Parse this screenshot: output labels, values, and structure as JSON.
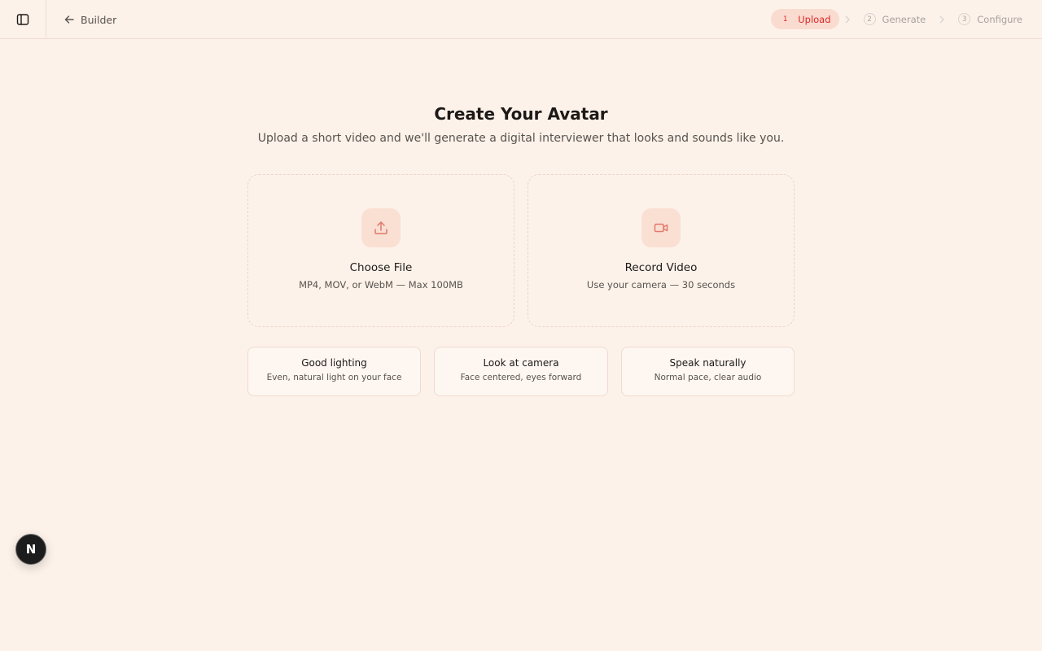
{
  "header": {
    "back_label": "Builder",
    "steps": [
      {
        "number": "1",
        "label": "Upload",
        "active": true
      },
      {
        "number": "2",
        "label": "Generate",
        "active": false
      },
      {
        "number": "3",
        "label": "Configure",
        "active": false
      }
    ]
  },
  "main": {
    "title": "Create Your Avatar",
    "subtitle": "Upload a short video and we'll generate a digital interviewer that looks and sounds like you.",
    "options": [
      {
        "icon": "upload-icon",
        "title": "Choose File",
        "description": "MP4, MOV, or WebM — Max 100MB"
      },
      {
        "icon": "video-camera-icon",
        "title": "Record Video",
        "description": "Use your camera — 30 seconds"
      }
    ],
    "tips": [
      {
        "title": "Good lighting",
        "description": "Even, natural light on your face"
      },
      {
        "title": "Look at camera",
        "description": "Face centered, eyes forward"
      },
      {
        "title": "Speak naturally",
        "description": "Normal pace, clear audio"
      }
    ]
  },
  "fab": {
    "label": "N"
  },
  "colors": {
    "background": "#fdf2ea",
    "accent": "#dc2626",
    "active_step_bg": "#fadbd0",
    "icon_tile_bg": "#fadfd3"
  }
}
